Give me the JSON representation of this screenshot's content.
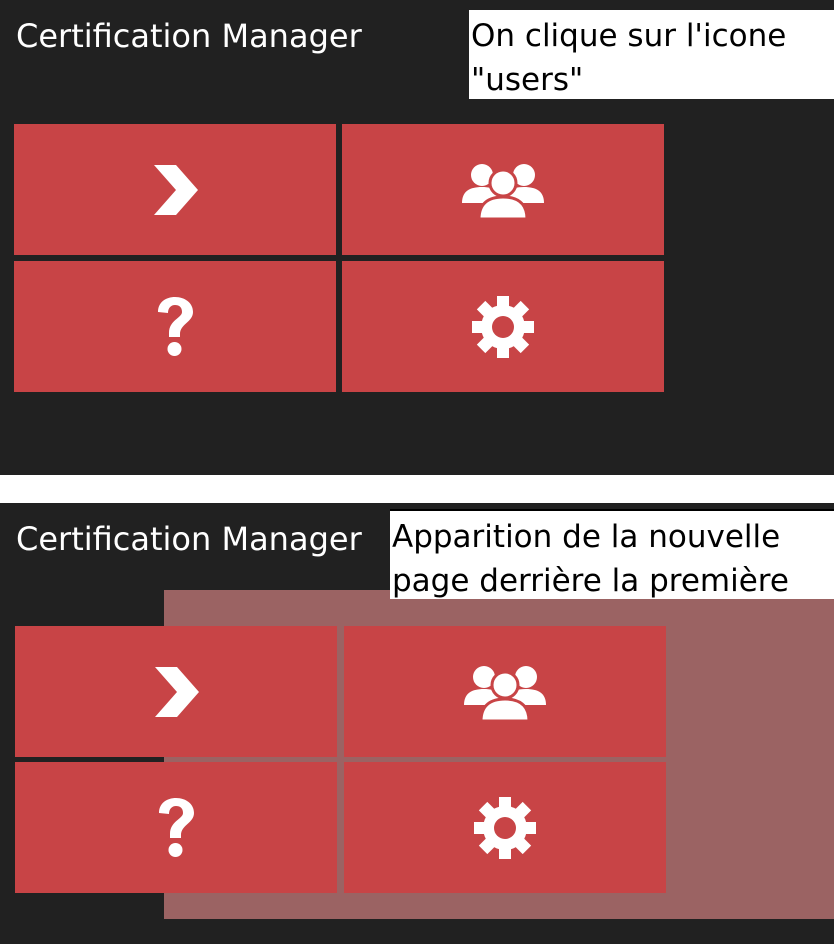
{
  "panels": [
    {
      "app_title": "Certification Manager",
      "caption": "On clique sur l'icone \"users\"",
      "tiles": [
        {
          "icon": "chevron-right-icon"
        },
        {
          "icon": "users-icon"
        },
        {
          "icon": "question-icon"
        },
        {
          "icon": "gear-icon"
        }
      ]
    },
    {
      "app_title": "Certification Manager",
      "caption": "Apparition de la nouvelle page derrière la première",
      "tiles": [
        {
          "icon": "chevron-right-icon"
        },
        {
          "icon": "users-icon"
        },
        {
          "icon": "question-icon"
        },
        {
          "icon": "gear-icon"
        }
      ]
    }
  ],
  "colors": {
    "background": "#212121",
    "tile": "#c84446",
    "back_page": "#9b6363",
    "icon": "#ffffff"
  }
}
